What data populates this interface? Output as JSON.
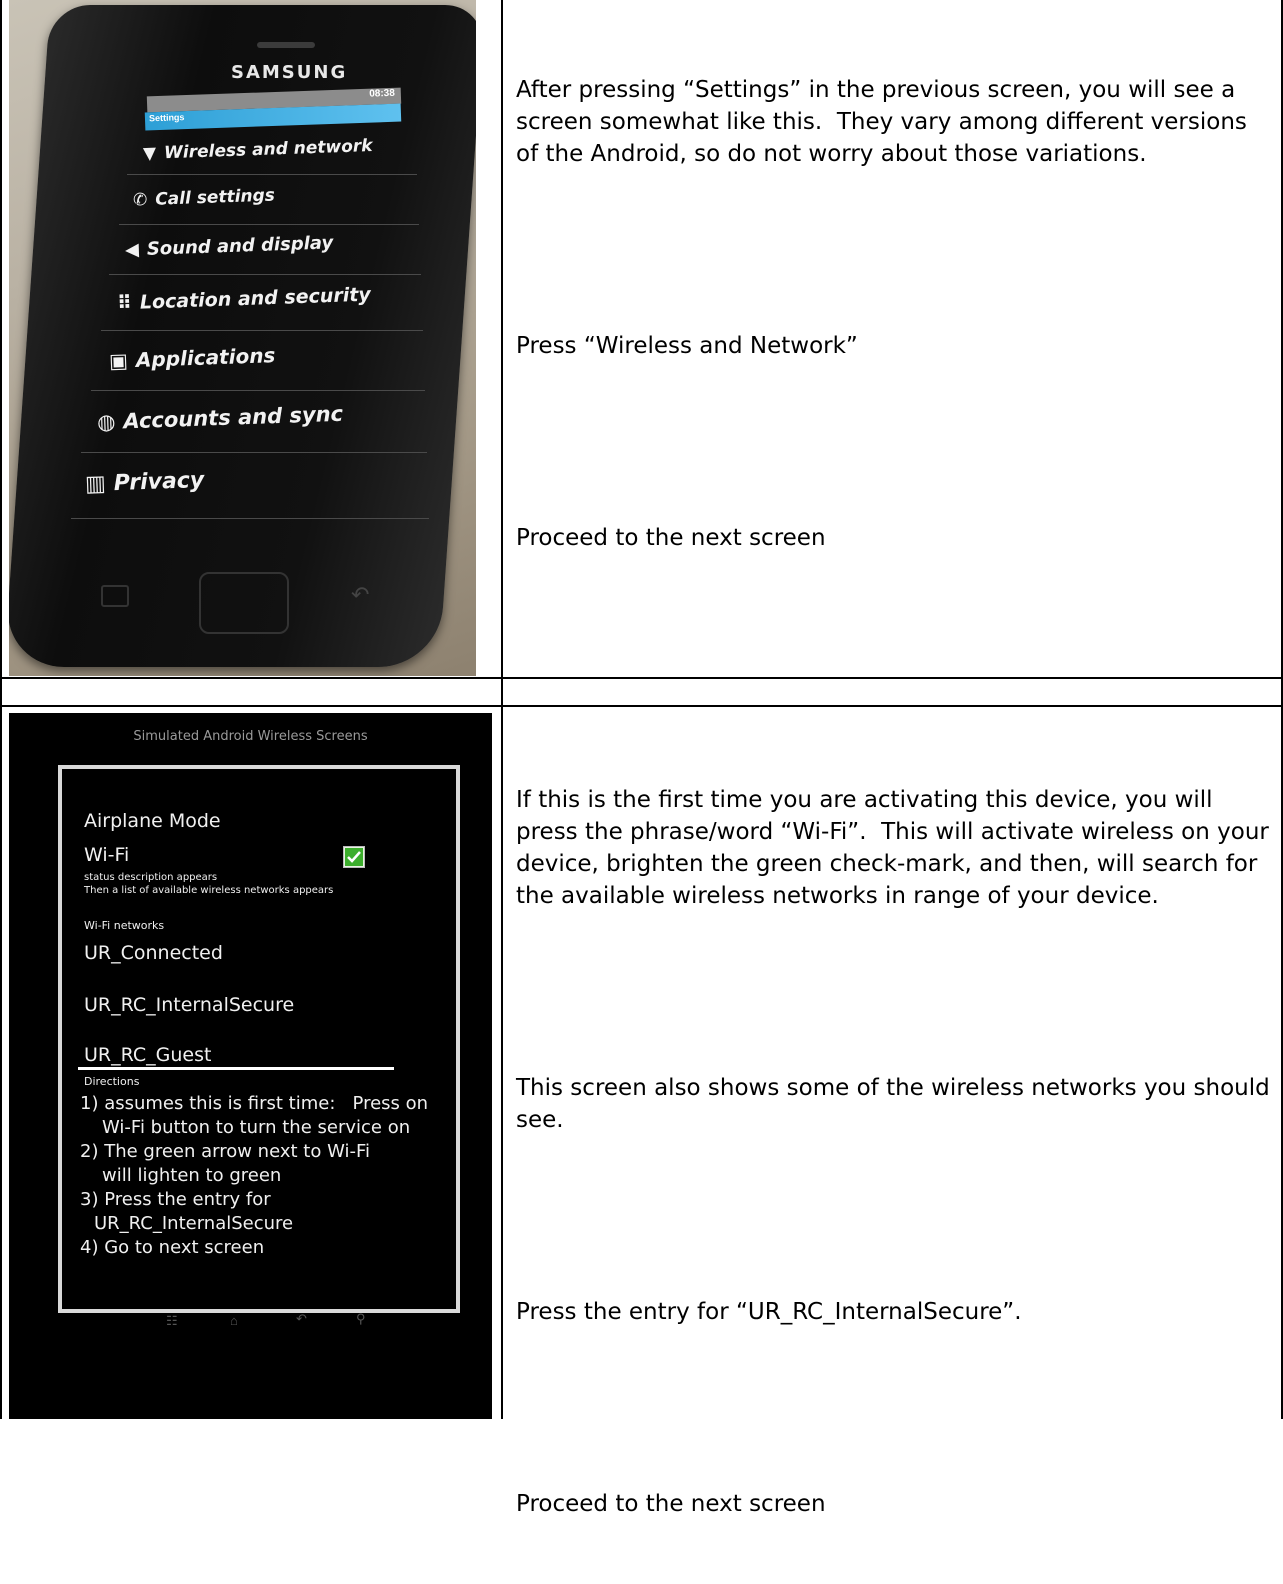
{
  "row1": {
    "phone": {
      "brand": "SAMSUNG",
      "status_time": "08:38",
      "header": "Settings",
      "items": [
        {
          "label": "Wireless and network",
          "icon": "wifi-icon"
        },
        {
          "label": "Call settings",
          "icon": "phone-icon"
        },
        {
          "label": "Sound and display",
          "icon": "speaker-icon"
        },
        {
          "label": "Location and security",
          "icon": "grid-lock-icon"
        },
        {
          "label": "Applications",
          "icon": "applications-icon"
        },
        {
          "label": "Accounts and sync",
          "icon": "sync-icon"
        },
        {
          "label": "Privacy",
          "icon": "privacy-icon"
        }
      ]
    },
    "paragraphs": [
      "After pressing “Settings” in the previous screen, you will see a screen somewhat like this.  They vary among different versions of the Android, so do not worry about those variations.",
      "Press “Wireless and Network”",
      "Proceed to the next screen"
    ]
  },
  "row2": {
    "sim": {
      "title": "Simulated Android Wireless Screens",
      "airplane_mode": "Airplane Mode",
      "wifi": "Wi-Fi",
      "status_description": "status description appears",
      "status_list": "Then a list of available wireless networks appears",
      "networks_label": "Wi-Fi networks",
      "networks": [
        "UR_Connected",
        "UR_RC_InternalSecure",
        "UR_RC_Guest"
      ],
      "directions_label": "Directions",
      "directions": [
        "1) assumes this is first time:   Press on",
        "Wi-Fi button to turn the service on",
        "2) The green arrow next to Wi-Fi",
        "will lighten to green",
        "3) Press the entry for",
        "UR_RC_InternalSecure",
        "4) Go to next screen"
      ],
      "check_color": "#3cae2c"
    },
    "paragraphs": [
      "If this is the first time you are activating this device, you will press the phrase/word “Wi-Fi”.  This will activate wireless on your device, brighten the green check-mark, and then, will search for the available wireless networks in range of your device.",
      "This screen also shows some of the wireless networks you should see.",
      "Press the entry for “UR_RC_InternalSecure”.",
      "Proceed to the next screen"
    ]
  }
}
